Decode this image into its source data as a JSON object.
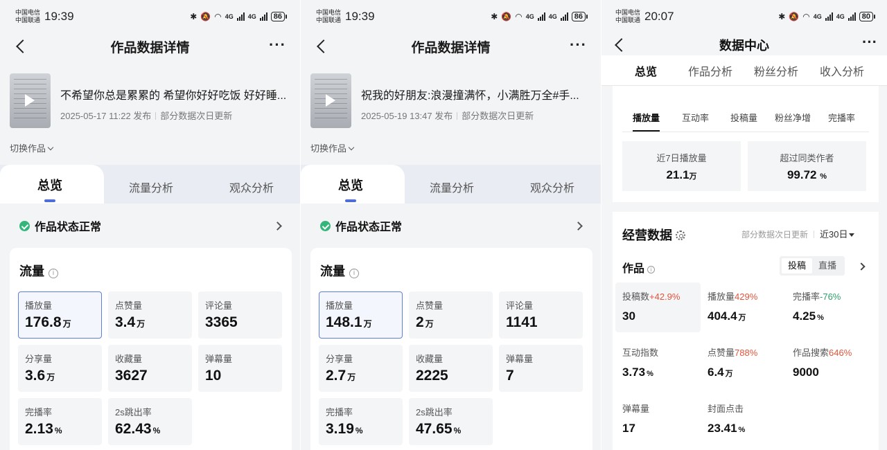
{
  "status_bars": [
    {
      "carrier1": "中国电信",
      "carrier2": "中国联通",
      "time": "19:39",
      "battery": "86",
      "net": "4G"
    },
    {
      "carrier1": "中国电信",
      "carrier2": "中国联通",
      "time": "19:39",
      "battery": "86",
      "net": "4G"
    },
    {
      "carrier1": "中国电信",
      "carrier2": "中国联通",
      "time": "20:07",
      "battery": "80",
      "net": "4G"
    }
  ],
  "work_panels": [
    {
      "page_title": "作品数据详情",
      "work_title": "不希望你总是累累的 希望你好好吃饭 好好睡...",
      "publish_time": "2025-05-17 11:22 发布",
      "update_note": "部分数据次日更新",
      "switch_label": "切换作品",
      "tabs": [
        "总览",
        "流量分析",
        "观众分析"
      ],
      "status_label": "作品状态正常",
      "traffic_title": "流量",
      "metrics": [
        {
          "label": "播放量",
          "value": "176.8",
          "unit": "万"
        },
        {
          "label": "点赞量",
          "value": "3.4",
          "unit": "万"
        },
        {
          "label": "评论量",
          "value": "3365",
          "unit": ""
        },
        {
          "label": "分享量",
          "value": "3.6",
          "unit": "万"
        },
        {
          "label": "收藏量",
          "value": "3627",
          "unit": ""
        },
        {
          "label": "弹幕量",
          "value": "10",
          "unit": ""
        },
        {
          "label": "完播率",
          "value": "2.13",
          "unit": "%"
        },
        {
          "label": "2s跳出率",
          "value": "62.43",
          "unit": "%"
        }
      ]
    },
    {
      "page_title": "作品数据详情",
      "work_title": "祝我的好朋友:浪漫撞满怀，小满胜万全#手...",
      "publish_time": "2025-05-19 13:47 发布",
      "update_note": "部分数据次日更新",
      "switch_label": "切换作品",
      "tabs": [
        "总览",
        "流量分析",
        "观众分析"
      ],
      "status_label": "作品状态正常",
      "traffic_title": "流量",
      "metrics": [
        {
          "label": "播放量",
          "value": "148.1",
          "unit": "万"
        },
        {
          "label": "点赞量",
          "value": "2",
          "unit": "万"
        },
        {
          "label": "评论量",
          "value": "1141",
          "unit": ""
        },
        {
          "label": "分享量",
          "value": "2.7",
          "unit": "万"
        },
        {
          "label": "收藏量",
          "value": "2225",
          "unit": ""
        },
        {
          "label": "弹幕量",
          "value": "7",
          "unit": ""
        },
        {
          "label": "完播率",
          "value": "3.19",
          "unit": "%"
        },
        {
          "label": "2s跳出率",
          "value": "47.65",
          "unit": "%"
        }
      ]
    }
  ],
  "data_center": {
    "page_title": "数据中心",
    "tabs": [
      "总览",
      "作品分析",
      "粉丝分析",
      "收入分析"
    ],
    "metric_tabs": [
      "播放量",
      "互动率",
      "投稿量",
      "粉丝净增",
      "完播率"
    ],
    "boxes": [
      {
        "label": "近7日播放量",
        "value": "21.1",
        "unit": "万"
      },
      {
        "label": "超过同类作者",
        "value": "99.72",
        "unit": "%"
      }
    ],
    "biz_title": "经营数据",
    "biz_note": "部分数据次日更新",
    "period": "近30日",
    "works_label": "作品",
    "seg": [
      "投稿",
      "直播"
    ],
    "metrics": [
      {
        "label": "投稿数",
        "change": "+42.9%",
        "trend": "up",
        "value": "30",
        "unit": ""
      },
      {
        "label": "播放量",
        "change": "429%",
        "trend": "up",
        "value": "404.4",
        "unit": "万"
      },
      {
        "label": "完播率",
        "change": "-76%",
        "trend": "down",
        "value": "4.25",
        "unit": "%"
      },
      {
        "label": "互动指数",
        "change": "",
        "trend": "",
        "value": "3.73",
        "unit": "%"
      },
      {
        "label": "点赞量",
        "change": "788%",
        "trend": "up",
        "value": "6.4",
        "unit": "万"
      },
      {
        "label": "作品搜索",
        "change": "646%",
        "trend": "up",
        "value": "9000",
        "unit": ""
      },
      {
        "label": "弹幕量",
        "change": "",
        "trend": "",
        "value": "17",
        "unit": ""
      },
      {
        "label": "封面点击",
        "change": "",
        "trend": "",
        "value": "23.41",
        "unit": "%"
      }
    ]
  }
}
